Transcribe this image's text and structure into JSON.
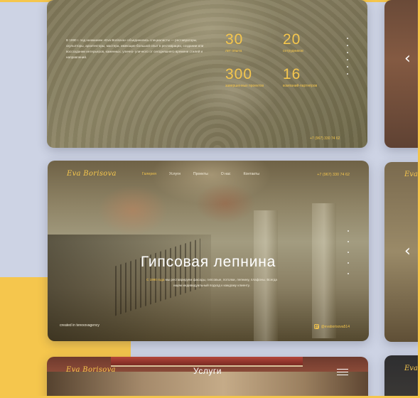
{
  "colors": {
    "accent": "#f5c64d",
    "background": "#cdd3e4"
  },
  "stats_card": {
    "description": "В 1990 г. под названием «Eva Borisova» объединились специалисты — реставраторы, скульпторы, архитекторы, мастера, имеющие большой опыт в реставрации, создании или воссоздании интерьеров, каменных, улично- уличного от сегодняшнего времени стилей и направлений.",
    "stats": [
      {
        "value": "30",
        "label": "лет опыта"
      },
      {
        "value": "20",
        "label": "сотрудников"
      },
      {
        "value": "300",
        "label": "завершенных проектов"
      },
      {
        "value": "16",
        "label": "компаний-партнёров"
      }
    ],
    "phone": "+7 (967) 330 74 62"
  },
  "hero_card": {
    "logo": "Eva Borisova",
    "nav": [
      {
        "label": "Галерея",
        "active": true
      },
      {
        "label": "Услуги",
        "active": false
      },
      {
        "label": "Проекты",
        "active": false
      },
      {
        "label": "О нас",
        "active": false
      },
      {
        "label": "Контакты",
        "active": false
      }
    ],
    "phone": "+7 (967) 330 74 62",
    "title": "Гипсовая лепнина",
    "subtitle_highlight": "С 1990 года",
    "subtitle_rest": " мы реставрируем фасады, гипсовые, потолки, лепнину, плафоны. Всегда ищем индивидуальный подход к каждому клиенту.",
    "created": "created in terexovagency",
    "instagram": "@evaborisova514"
  },
  "services_card": {
    "logo": "Eva Borisova",
    "title": "Услуги"
  },
  "side_cards": {
    "logo_partial": "Eva",
    "chevron_icon": "chevron-left-icon"
  }
}
